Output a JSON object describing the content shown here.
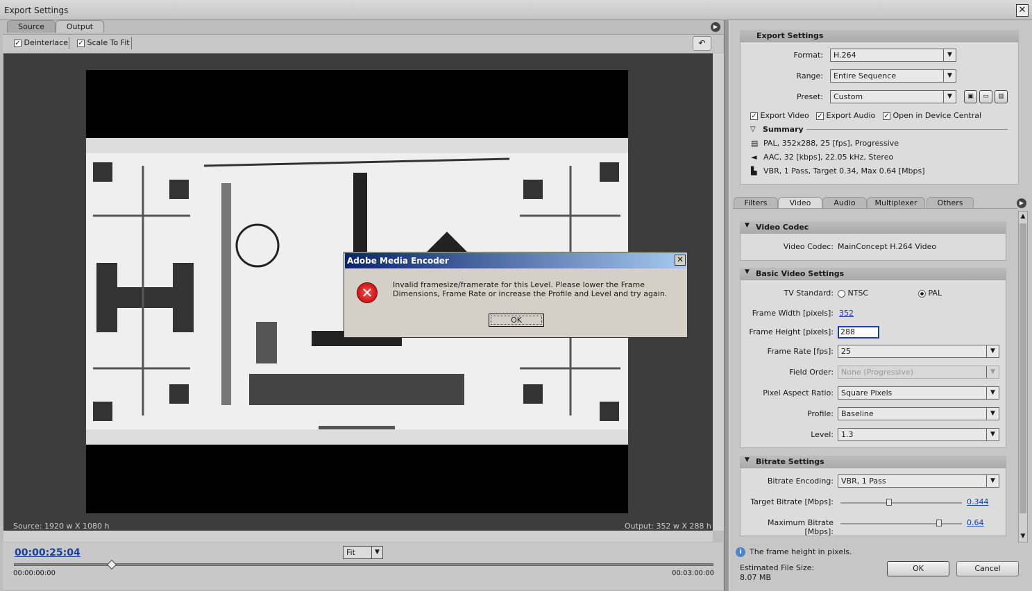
{
  "window": {
    "title": "Export Settings",
    "close": "✕"
  },
  "left": {
    "tabs": [
      "Source",
      "Output"
    ],
    "options": {
      "deinterlace": "Deinterlace",
      "scale_to_fit": "Scale To Fit"
    },
    "source_info": "Source: 1920 w X 1080 h",
    "output_info": "Output: 352 w X 288 h",
    "timecode": "00:00:25:04",
    "zoom": "Fit",
    "time_start": "00:00:00:00",
    "time_end": "00:03:00:00",
    "playhead_fraction": 0.14
  },
  "export_settings": {
    "header": "Export Settings",
    "format_label": "Format:",
    "format_value": "H.264",
    "range_label": "Range:",
    "range_value": "Entire Sequence",
    "preset_label": "Preset:",
    "preset_value": "Custom",
    "export_video": "Export Video",
    "export_audio": "Export Audio",
    "open_device_central": "Open in Device Central",
    "summary_label": "Summary",
    "summary_lines": [
      "PAL, 352x288, 25 [fps], Progressive",
      "AAC, 32 [kbps], 22.05 kHz, Stereo",
      "VBR, 1 Pass, Target 0.34, Max 0.64 [Mbps]"
    ]
  },
  "tabs": [
    "Filters",
    "Video",
    "Audio",
    "Multiplexer",
    "Others"
  ],
  "video_codec": {
    "header": "Video Codec",
    "label": "Video Codec:",
    "value": "MainConcept H.264 Video"
  },
  "basic_video": {
    "header": "Basic Video Settings",
    "tv_standard_label": "TV Standard:",
    "ntsc": "NTSC",
    "pal": "PAL",
    "width_label": "Frame Width [pixels]:",
    "width_value": "352",
    "height_label": "Frame Height [pixels]:",
    "height_value": "288",
    "framerate_label": "Frame Rate [fps]:",
    "framerate_value": "25",
    "field_order_label": "Field Order:",
    "field_order_value": "None (Progressive)",
    "par_label": "Pixel Aspect Ratio:",
    "par_value": "Square Pixels",
    "profile_label": "Profile:",
    "profile_value": "Baseline",
    "level_label": "Level:",
    "level_value": "1.3"
  },
  "bitrate": {
    "header": "Bitrate Settings",
    "encoding_label": "Bitrate Encoding:",
    "encoding_value": "VBR, 1 Pass",
    "target_label": "Target Bitrate [Mbps]:",
    "target_value": "0.344",
    "target_fraction": 0.4,
    "max_label": "Maximum Bitrate [Mbps]:",
    "max_value": "0.64",
    "max_fraction": 0.81
  },
  "footer": {
    "hint": "The frame height in pixels.",
    "estimated_label": "Estimated File Size:",
    "estimated_value": "8.07 MB",
    "ok": "OK",
    "cancel": "Cancel"
  },
  "dialog": {
    "title": "Adobe Media Encoder",
    "message": "Invalid framesize/framerate for this Level. Please lower the Frame Dimensions, Frame Rate or increase the Profile and Level and try again.",
    "ok": "OK"
  },
  "colors": {
    "link": "#1a3f9a",
    "dialog_title": "#0a246a",
    "error": "#c00000"
  }
}
